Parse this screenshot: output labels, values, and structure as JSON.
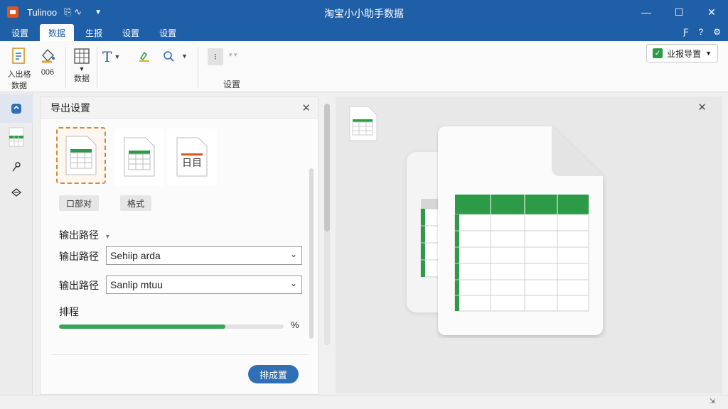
{
  "titlebar": {
    "app_name": "Tulinoo",
    "quick_access": "⎘ ∿",
    "window_title": "淘宝小小助手数据",
    "minimize": "—",
    "maximize": "☐",
    "close": "✕"
  },
  "menu_tabs": [
    "设置",
    "数据",
    "生报",
    "设置",
    "设置"
  ],
  "menu_right": {
    "user": "Ƒ",
    "help": "?",
    "settings": "⚙"
  },
  "ribbon": {
    "btn1_label": "入出格",
    "btn1_sub": "数据",
    "btn2_label": "006",
    "btn3_label": "数据",
    "group_label": "设置",
    "export_guide": "业报导置"
  },
  "panel": {
    "title": "导出设置",
    "format1_label": "口部对",
    "format2_label": "格式",
    "format3_text": "日目",
    "output_path_header": "输出路径",
    "output_path_label1": "输出路径",
    "output_path_value1": "Sehiip arda",
    "output_path_label2": "输出路径",
    "output_path_value2": "Sanlip mtuu",
    "progress_label": "排程",
    "progress_end": "%",
    "progress_value": 0.74,
    "submit_button": "排成置"
  },
  "colors": {
    "titlebar": "#1f5fa8",
    "accent_green": "#3aa655",
    "primary_button": "#2f6fb6",
    "selected_border": "#cf8a3d"
  }
}
